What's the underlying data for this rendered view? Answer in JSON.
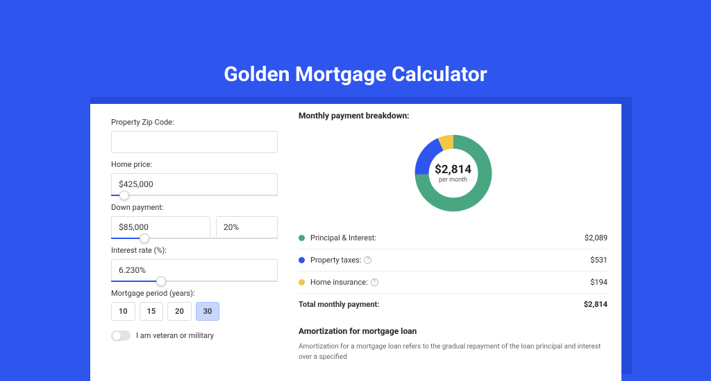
{
  "title": "Golden Mortgage Calculator",
  "chart_data": {
    "type": "pie",
    "title": "Monthly payment breakdown",
    "center_value": "$2,814",
    "center_sub": "per month",
    "series": [
      {
        "name": "Principal & Interest",
        "value": 2089,
        "color": "#48a681"
      },
      {
        "name": "Property taxes",
        "value": 531,
        "color": "#2e55ee"
      },
      {
        "name": "Home insurance",
        "value": 194,
        "color": "#f1c749"
      }
    ],
    "total": {
      "label": "Total monthly payment:",
      "value": 2814
    }
  },
  "form": {
    "zip": {
      "label": "Property Zip Code:",
      "value": ""
    },
    "home_price": {
      "label": "Home price:",
      "value": "$425,000",
      "slider_pct": 8
    },
    "down_payment": {
      "label": "Down payment:",
      "value": "$85,000",
      "pct_value": "20%",
      "slider_pct": 20
    },
    "interest": {
      "label": "Interest rate (%):",
      "value": "6.230%",
      "slider_pct": 30
    },
    "term": {
      "label": "Mortgage period (years):",
      "options": [
        "10",
        "15",
        "20",
        "30"
      ],
      "active": "30"
    },
    "veteran": {
      "label": "I am veteran or military",
      "checked": false
    }
  },
  "breakdown": {
    "heading": "Monthly payment breakdown:",
    "rows": [
      {
        "dot": "#48a681",
        "label": "Principal & Interest:",
        "info": false,
        "value": "$2,089"
      },
      {
        "dot": "#2e55ee",
        "label": "Property taxes:",
        "info": true,
        "value": "$531"
      },
      {
        "dot": "#f1c749",
        "label": "Home insurance:",
        "info": true,
        "value": "$194"
      }
    ],
    "total": {
      "label": "Total monthly payment:",
      "value": "$2,814"
    }
  },
  "amortization": {
    "heading": "Amortization for mortgage loan",
    "text": "Amortization for a mortgage loan refers to the gradual repayment of the loan principal and interest over a specified"
  }
}
